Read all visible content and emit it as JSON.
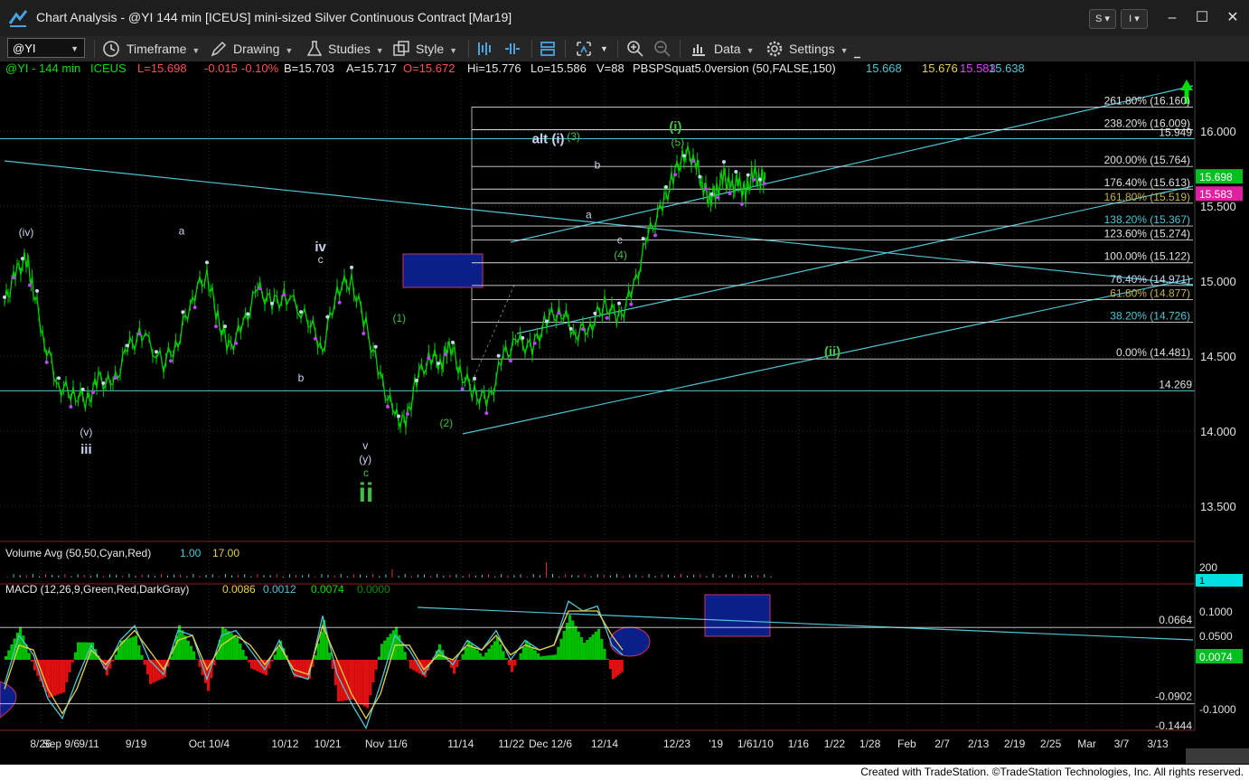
{
  "window": {
    "title": "Chart Analysis - @YI 144 min [ICEUS] mini-sized Silver Continuous Contract [Mar19]",
    "s_button": "S",
    "i_button": "I",
    "minimize": "–",
    "maximize": "☐",
    "close": "✕"
  },
  "toolbar": {
    "symbol": "@YI",
    "timeframe": "Timeframe",
    "drawing": "Drawing",
    "studies": "Studies",
    "style": "Style",
    "data": "Data",
    "settings": "Settings"
  },
  "colors": {
    "background": "#000000",
    "price_up": "#00d000",
    "swing_marker": "#c040ff",
    "trendline": "#4ec5d6",
    "fib_line": "#d9d9d9",
    "wave_label_white": "#c8d4f0",
    "wave_label_green": "#40c040",
    "macd_up": "#00c000",
    "macd_down": "#e01010",
    "macd_line": "#4ec5d6",
    "signal_line": "#e6d24a",
    "box_fill": "#0a1f8a",
    "box_border": "#d0306a",
    "footer_bg": "#ffffff"
  },
  "price_header": {
    "symbol": "@YI - 144 min",
    "exchange": "ICEUS",
    "last": "L=15.698",
    "change": "-0.015",
    "change_pct": "-0.10%",
    "bid": "B=15.703",
    "ask": "A=15.717",
    "open": "O=15.672",
    "high": "Hi=15.776",
    "low": "Lo=15.586",
    "volume": "V=88",
    "study": "PBSPSquat5.0version (50,FALSE,150)",
    "study_v1": "15.668",
    "study_v2": "15.676",
    "study_v3": "15.583",
    "study_v4": "15.638"
  },
  "volume_header": {
    "label": "Volume Avg (50,50,Cyan,Red)",
    "v1": "1.00",
    "v2": "17.00"
  },
  "macd_header": {
    "label": "MACD (12,26,9,Green,Red,DarkGray)",
    "v1": "0.0086",
    "v2": "0.0012",
    "v3": "0.0074",
    "v4": "0.0000"
  },
  "chart_data": {
    "type": "line",
    "title": "Chart Analysis - @YI 144 min [ICEUS] mini-sized Silver Continuous Contract [Mar19]",
    "xlabel": "",
    "ylabel": "",
    "ylim": [
      13.25,
      16.5
    ],
    "grid": true,
    "y_ticks": [
      "16.000",
      "15.500",
      "15.000",
      "14.500",
      "14.000",
      "13.500"
    ],
    "y_tick_values": [
      16.0,
      15.5,
      15.0,
      14.5,
      14.0,
      13.5
    ],
    "x_ticks": [
      "8/26",
      "Sep 9/6",
      "9/11",
      "9/19",
      "Oct 10/4",
      "10/12",
      "10/21",
      "Nov 11/6",
      "11/14",
      "11/22",
      "Dec 12/6",
      "12/14",
      "12/23",
      "'19",
      "1/6",
      "1/10",
      "1/16",
      "1/22",
      "1/28",
      "Feb",
      "2/7",
      "2/13",
      "2/19",
      "2/25",
      "Mar",
      "3/7",
      "3/13"
    ],
    "x_tick_bars": [
      0.05,
      0.078,
      0.117,
      0.182,
      0.283,
      0.388,
      0.447,
      0.528,
      0.631,
      0.701,
      0.755,
      0.83,
      0.93,
      0.984,
      1.024,
      1.049,
      1.098,
      1.148,
      1.197,
      1.248,
      1.297,
      1.347,
      1.397,
      1.447,
      1.497,
      1.545,
      1.595
    ],
    "series": [
      {
        "name": "",
        "x": [
          0.0,
          0.015,
          0.03,
          0.04,
          0.055,
          0.075,
          0.095,
          0.115,
          0.13,
          0.15,
          0.17,
          0.19,
          0.22,
          0.24,
          0.26,
          0.28,
          0.295,
          0.31,
          0.33,
          0.35,
          0.37,
          0.39,
          0.42,
          0.44,
          0.46,
          0.48,
          0.5,
          0.52,
          0.54,
          0.555,
          0.57,
          0.59,
          0.605,
          0.615,
          0.63,
          0.65,
          0.67,
          0.69,
          0.71,
          0.73,
          0.75,
          0.77,
          0.79,
          0.81,
          0.83,
          0.85,
          0.87,
          0.89,
          0.91,
          0.925,
          0.94,
          0.955,
          0.965,
          0.975,
          0.985,
          0.995,
          1.005,
          1.015,
          1.025,
          1.035,
          1.045,
          1.052
        ],
        "y": [
          14.85,
          15.05,
          15.15,
          14.95,
          14.6,
          14.3,
          14.25,
          14.2,
          14.35,
          14.3,
          14.55,
          14.65,
          14.45,
          14.6,
          14.9,
          15.05,
          14.75,
          14.55,
          14.7,
          14.95,
          14.85,
          14.9,
          14.75,
          14.55,
          14.95,
          15.0,
          14.7,
          14.35,
          14.1,
          14.05,
          14.35,
          14.5,
          14.45,
          14.6,
          14.4,
          14.25,
          14.2,
          14.5,
          14.6,
          14.55,
          14.75,
          14.8,
          14.65,
          14.7,
          14.85,
          14.75,
          14.95,
          15.3,
          15.5,
          15.7,
          15.85,
          15.82,
          15.65,
          15.55,
          15.6,
          15.7,
          15.62,
          15.65,
          15.58,
          15.72,
          15.68,
          15.7
        ]
      }
    ],
    "fib_levels": [
      {
        "label": "261.80% (16.160)",
        "value": 16.16
      },
      {
        "label": "238.20% (16.009)",
        "value": 16.009
      },
      {
        "label": "200.00% (15.764)",
        "value": 15.764
      },
      {
        "label": "176.40% (15.613)",
        "value": 15.613
      },
      {
        "label": "161.80% (15.519)",
        "value": 15.519
      },
      {
        "label": "138.20% (15.367)",
        "value": 15.367
      },
      {
        "label": "123.60% (15.274)",
        "value": 15.274
      },
      {
        "label": "100.00% (15.122)",
        "value": 15.122
      },
      {
        "label": "76.40% (14.971)",
        "value": 14.971
      },
      {
        "label": "61.80% (14.877)",
        "value": 14.877
      },
      {
        "label": "38.20% (14.726)",
        "value": 14.726
      },
      {
        "label": "0.00% (14.481)",
        "value": 14.481
      }
    ],
    "horizontal_levels": [
      {
        "label": "15.949",
        "value": 15.949
      },
      {
        "label": "14.269",
        "value": 14.269
      }
    ],
    "price_tags": [
      {
        "label": "15.698",
        "value": 15.698
      },
      {
        "label": "15.583",
        "value": 15.583
      }
    ],
    "wave_labels": [
      {
        "text": "(iv)",
        "x": 0.03,
        "y": 15.3
      },
      {
        "text": "(v)",
        "x": 0.113,
        "y": 13.97
      },
      {
        "text": "iii",
        "x": 0.113,
        "y": 13.85
      },
      {
        "text": "a",
        "x": 0.245,
        "y": 15.31
      },
      {
        "text": "b",
        "x": 0.41,
        "y": 14.33
      },
      {
        "text": "iv",
        "x": 0.437,
        "y": 15.2
      },
      {
        "text": "c",
        "x": 0.437,
        "y": 15.12
      },
      {
        "text": "v",
        "x": 0.499,
        "y": 13.88
      },
      {
        "text": "(y)",
        "x": 0.499,
        "y": 13.79
      },
      {
        "text": "c",
        "x": 0.5,
        "y": 13.7
      },
      {
        "text": "ii",
        "x": 0.5,
        "y": 13.53
      },
      {
        "text": "(1)",
        "x": 0.546,
        "y": 14.73
      },
      {
        "text": "(2)",
        "x": 0.611,
        "y": 14.03
      },
      {
        "text": "alt (i)",
        "x": 0.752,
        "y": 15.92
      },
      {
        "text": "(3)",
        "x": 0.787,
        "y": 15.94
      },
      {
        "text": "b",
        "x": 0.82,
        "y": 15.75
      },
      {
        "text": "a",
        "x": 0.808,
        "y": 15.42
      },
      {
        "text": "c",
        "x": 0.851,
        "y": 15.25
      },
      {
        "text": "(4)",
        "x": 0.852,
        "y": 15.15
      },
      {
        "text": "(i)",
        "x": 0.928,
        "y": 16.0
      },
      {
        "text": "(5)",
        "x": 0.931,
        "y": 15.9
      },
      {
        "text": "(ii)",
        "x": 1.145,
        "y": 14.5
      }
    ],
    "volume_ticks": [
      "200",
      "1"
    ],
    "macd_ticks": [
      "0.1000",
      "0.0664",
      "0.0500",
      "0.0074",
      "-0.0902",
      "-0.1000",
      "-0.1444"
    ],
    "macd_tick_values": [
      0.1,
      0.0664,
      0.05,
      0.0074,
      -0.0902,
      -0.1,
      -0.1444
    ],
    "macd": {
      "x": [
        0.0,
        0.02,
        0.04,
        0.06,
        0.08,
        0.1,
        0.12,
        0.14,
        0.16,
        0.18,
        0.2,
        0.22,
        0.24,
        0.26,
        0.28,
        0.3,
        0.32,
        0.34,
        0.36,
        0.38,
        0.4,
        0.42,
        0.44,
        0.46,
        0.48,
        0.5,
        0.52,
        0.54,
        0.56,
        0.58,
        0.6,
        0.62,
        0.64,
        0.66,
        0.68,
        0.7,
        0.72,
        0.74,
        0.76,
        0.78,
        0.8,
        0.82,
        0.84,
        0.855
      ],
      "macd": [
        -0.05,
        0.05,
        0.01,
        -0.08,
        -0.12,
        -0.04,
        0.03,
        -0.02,
        0.04,
        0.07,
        0.0,
        -0.03,
        0.06,
        0.05,
        -0.04,
        0.05,
        0.06,
        0.02,
        -0.02,
        0.04,
        -0.03,
        -0.04,
        0.09,
        -0.03,
        -0.09,
        -0.14,
        -0.05,
        0.05,
        0.02,
        -0.03,
        0.02,
        -0.01,
        0.04,
        0.02,
        0.06,
        0.0,
        0.04,
        0.02,
        0.03,
        0.12,
        0.1,
        0.11,
        0.03,
        0.01
      ],
      "signal": [
        -0.06,
        0.03,
        0.02,
        -0.06,
        -0.11,
        -0.06,
        0.02,
        -0.01,
        0.03,
        0.06,
        0.02,
        -0.02,
        0.04,
        0.05,
        -0.02,
        0.03,
        0.05,
        0.03,
        -0.01,
        0.03,
        -0.02,
        -0.03,
        0.07,
        0.0,
        -0.07,
        -0.12,
        -0.07,
        0.03,
        0.03,
        -0.02,
        0.01,
        0.0,
        0.03,
        0.02,
        0.05,
        0.01,
        0.03,
        0.02,
        0.03,
        0.1,
        0.1,
        0.1,
        0.05,
        0.02
      ]
    }
  },
  "footer": {
    "text": "Created with TradeStation. ©TradeStation Technologies, Inc. All rights reserved."
  }
}
